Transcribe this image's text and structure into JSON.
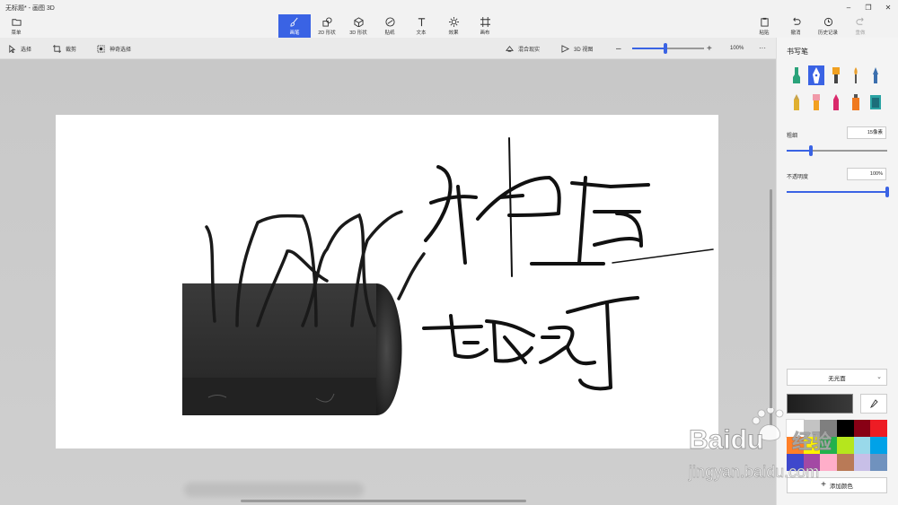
{
  "app": {
    "title": "无标题* - 画图 3D"
  },
  "ribbon": {
    "menu_label": "菜单",
    "tabs": [
      {
        "label": "画笔",
        "icon": "brush-icon",
        "active": true
      },
      {
        "label": "2D 形状",
        "icon": "2d-shapes-icon"
      },
      {
        "label": "3D 形状",
        "icon": "3d-shapes-icon"
      },
      {
        "label": "贴纸",
        "icon": "stickers-icon"
      },
      {
        "label": "文本",
        "icon": "text-icon"
      },
      {
        "label": "效果",
        "icon": "effects-icon"
      },
      {
        "label": "画布",
        "icon": "canvas-icon"
      }
    ],
    "right_actions": [
      {
        "label": "粘贴",
        "icon": "paste-icon"
      },
      {
        "label": "撤消",
        "icon": "undo-icon"
      },
      {
        "label": "历史记录",
        "icon": "history-icon"
      },
      {
        "label": "重做",
        "icon": "redo-icon",
        "disabled": true
      }
    ]
  },
  "toolbar": {
    "select_label": "选择",
    "crop_label": "裁剪",
    "magic_select_label": "神奇选择",
    "mixed_reality_label": "混合现实",
    "view3d_label": "3D 视图",
    "zoom_value": "100%",
    "zoom_fraction": 0.46,
    "more_label": "···"
  },
  "panel": {
    "title": "书写笔",
    "thickness_label": "粗细",
    "thickness_value": "15像素",
    "thickness_fraction": 0.24,
    "opacity_label": "不透明度",
    "opacity_value": "100%",
    "opacity_fraction": 1.0,
    "finish_label": "无光面",
    "add_color_label": "添加颜色",
    "current_color": "#1e1e1e",
    "palette": [
      "#ffffff",
      "#c3c3c3",
      "#7f7f7f",
      "#000000",
      "#880015",
      "#ed1c24",
      "#ff7f27",
      "#fff200",
      "#22b14c",
      "#b5e61d",
      "#99d9ea",
      "#00a2e8",
      "#3f48cc",
      "#a349a4",
      "#ffaec9",
      "#b97a57",
      "#c8bfe7",
      "#7092be"
    ],
    "accent": "#3a63e4"
  },
  "watermark": {
    "brand": "Baidu",
    "brand_cn": "经验",
    "url": "jingyan.baidu.com"
  }
}
